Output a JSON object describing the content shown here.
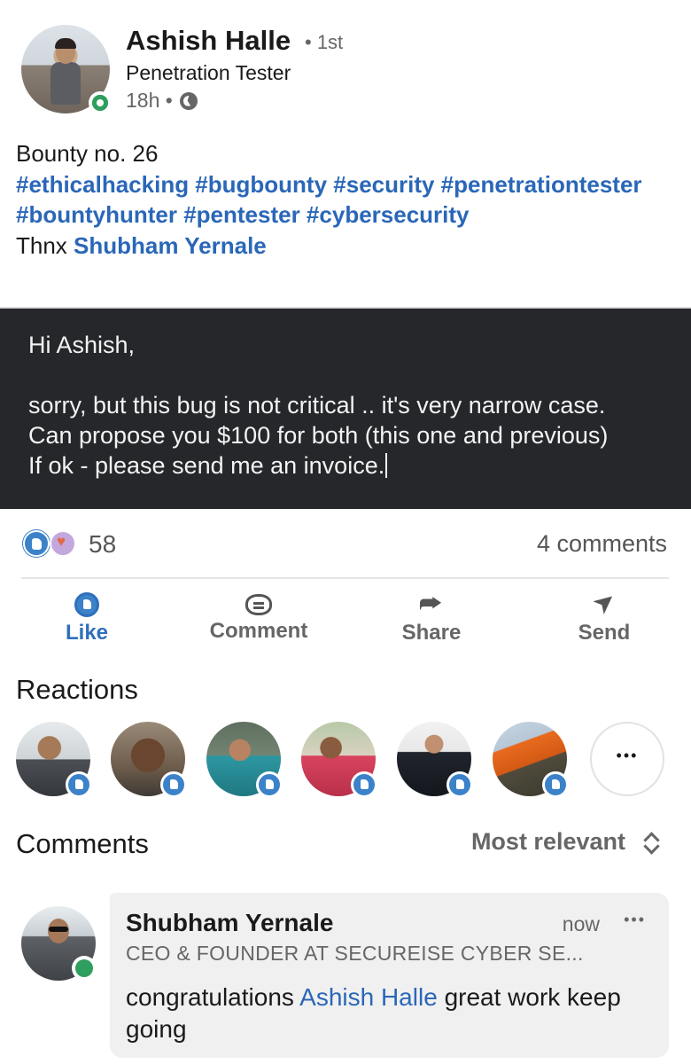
{
  "post": {
    "author": {
      "name": "Ashish Halle",
      "degree": "• 1st",
      "headline": "Penetration Tester",
      "time": "18h •",
      "visibility_icon": "globe-icon",
      "online_status_color": "#2f9e5e"
    },
    "text": {
      "line1": "Bounty no. 26",
      "hashtags": "#ethicalhacking #bugbounty #security #penetrationtester #bountyhunter #pentester #cybersecurity",
      "thanks_prefix": "Thnx",
      "thanks_mention": "Shubham Yernale"
    },
    "image_message": "Hi Ashish,\n\nsorry, but this bug is not critical .. it's very narrow case.\nCan propose you $100 for both (this one and previous)\nIf ok - please send me an invoice."
  },
  "social": {
    "reaction_icons": [
      "like-reaction-icon",
      "love-reaction-icon"
    ],
    "reaction_count": "58",
    "comments_count": "4 comments"
  },
  "actions": {
    "like": "Like",
    "comment": "Comment",
    "share": "Share",
    "send": "Send"
  },
  "reactions": {
    "title": "Reactions",
    "reactor_count_shown": 6
  },
  "comments": {
    "title": "Comments",
    "sort_label": "Most relevant",
    "items": [
      {
        "name": "Shubham Yernale",
        "time": "now",
        "headline": "CEO & FOUNDER AT SECUREISE CYBER SE...",
        "text_prefix": "congratulations",
        "mention": "Ashish Halle",
        "text_suffix": "great work keep going"
      }
    ]
  },
  "colors": {
    "accent_blue": "#2a67b8",
    "image_background": "#25272b",
    "online_green": "#2f9e5e"
  }
}
